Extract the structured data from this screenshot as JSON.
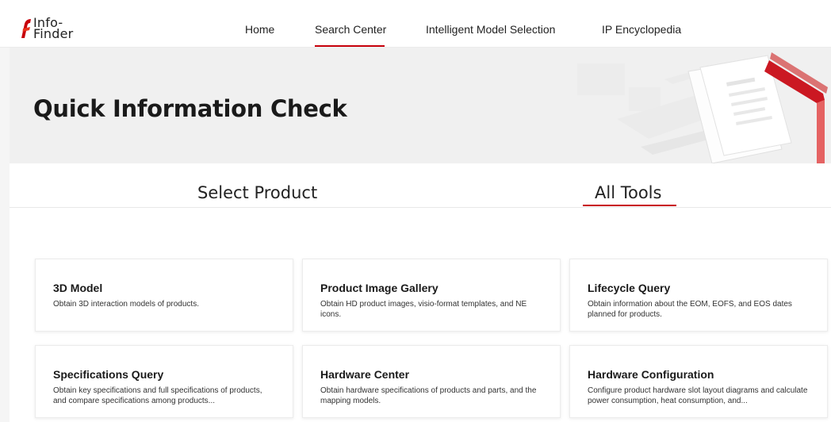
{
  "logo": {
    "line1": "Info-",
    "line2": "Finder",
    "accent": "#c7000b"
  },
  "nav": {
    "home": "Home",
    "search_center": "Search Center",
    "intelligent_model_selection": "Intelligent Model Selection",
    "ip_encyclopedia": "IP Encyclopedia",
    "active": "search_center"
  },
  "hero": {
    "title": "Quick Information Check"
  },
  "tabs": {
    "select_product": "Select Product",
    "all_tools": "All Tools",
    "active": "all_tools"
  },
  "cards": [
    {
      "title": "3D Model",
      "desc": "Obtain 3D interaction models of products."
    },
    {
      "title": "Product Image Gallery",
      "desc": "Obtain HD product images, visio-format templates, and NE icons."
    },
    {
      "title": "Lifecycle Query",
      "desc": "Obtain information about the EOM, EOFS, and EOS dates planned for products."
    },
    {
      "title": "Specifications Query",
      "desc": "Obtain key specifications and full specifications of products, and compare specifications among products..."
    },
    {
      "title": "Hardware Center",
      "desc": "Obtain hardware specifications of products and parts, and the mapping models."
    },
    {
      "title": "Hardware Configuration",
      "desc": "Configure product hardware slot layout diagrams and calculate power consumption, heat consumption, and..."
    }
  ],
  "colors": {
    "accent": "#c7000b",
    "hero_bg": "#f0f0f0",
    "page_bg": "#ffffff"
  }
}
